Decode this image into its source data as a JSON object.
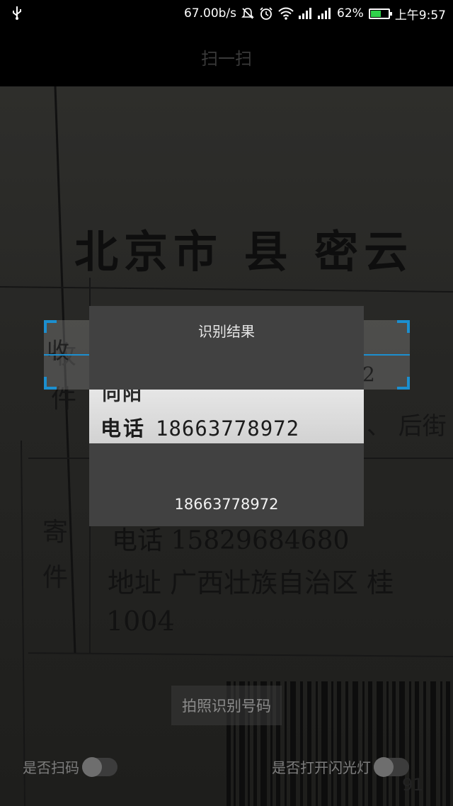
{
  "status_bar": {
    "network_speed": "67.00b/s",
    "battery_percent": "62%",
    "battery_level": 0.62,
    "time": "上午9:57",
    "icons": [
      "usb-icon",
      "mute-icon",
      "alarm-icon",
      "wifi-icon",
      "signal-icon",
      "signal-icon",
      "battery-icon"
    ]
  },
  "header": {
    "title": "扫一扫"
  },
  "camera_preview": {
    "big_text": "北京市 县 密云",
    "side_chars_top": [
      "收",
      "件"
    ],
    "side_chars_bottom": [
      "寄",
      "件"
    ],
    "row1": "电话 15829684680",
    "row2": "地址 广西壮族自治区 桂",
    "row3": "1004",
    "right_fragment": "、 后街",
    "scan_digit": "2",
    "barcode_text": "91"
  },
  "dialog": {
    "title": "识别结果",
    "image_top_text": "向阳",
    "image_label": "电话",
    "image_number": "18663778972",
    "result": "18663778972"
  },
  "controls": {
    "photo_button": "拍照识别号码",
    "scan_toggle_label": "是否扫码",
    "scan_toggle_on": false,
    "flash_toggle_label": "是否打开闪光灯",
    "flash_toggle_on": false
  },
  "colors": {
    "scan_accent": "#1c8fcf",
    "dialog_bg": "#414141",
    "battery_fill": "#2fd14a"
  }
}
